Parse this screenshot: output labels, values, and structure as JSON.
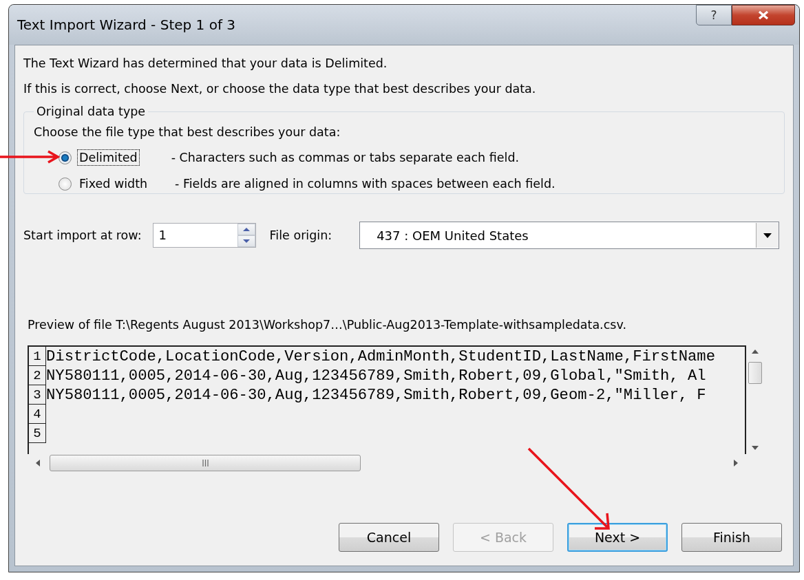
{
  "window": {
    "title": "Text Import Wizard - Step 1 of 3",
    "help": "?"
  },
  "intro": [
    "The Text Wizard has determined that your data is Delimited.",
    "If this is correct, choose Next, or choose the data type that best describes your data."
  ],
  "data_type_group": {
    "legend": "Original data type",
    "prompt": "Choose the file type that best describes your data:",
    "options": [
      {
        "label": "Delimited",
        "description": "- Characters such as commas or tabs separate each field.",
        "selected": true,
        "focused": true
      },
      {
        "label": "Fixed width",
        "description": "- Fields are aligned in columns with spaces between each field.",
        "selected": false,
        "focused": false
      }
    ]
  },
  "start_row": {
    "label": "Start import at row:",
    "value": "1"
  },
  "file_origin": {
    "label": "File origin:",
    "value": "437 : OEM United States"
  },
  "preview": {
    "caption": "Preview of file T:\\Regents August 2013\\Workshop7…\\Public-Aug2013-Template-withsampledata.csv.",
    "rows": [
      {
        "number": "1",
        "text": "DistrictCode,LocationCode,Version,AdminMonth,StudentID,LastName,FirstName"
      },
      {
        "number": "2",
        "text": "NY580111,0005,2014-06-30,Aug,123456789,Smith,Robert,09,Global,\"Smith, Al"
      },
      {
        "number": "3",
        "text": "NY580111,0005,2014-06-30,Aug,123456789,Smith,Robert,09,Geom-2,\"Miller, F"
      },
      {
        "number": "4",
        "text": ""
      },
      {
        "number": "5",
        "text": ""
      }
    ]
  },
  "buttons": [
    {
      "label": "Cancel",
      "disabled": false,
      "default": false
    },
    {
      "label": "< Back",
      "disabled": true,
      "default": false
    },
    {
      "label": "Next >",
      "disabled": false,
      "default": true
    },
    {
      "label": "Finish",
      "disabled": false,
      "default": false
    }
  ]
}
